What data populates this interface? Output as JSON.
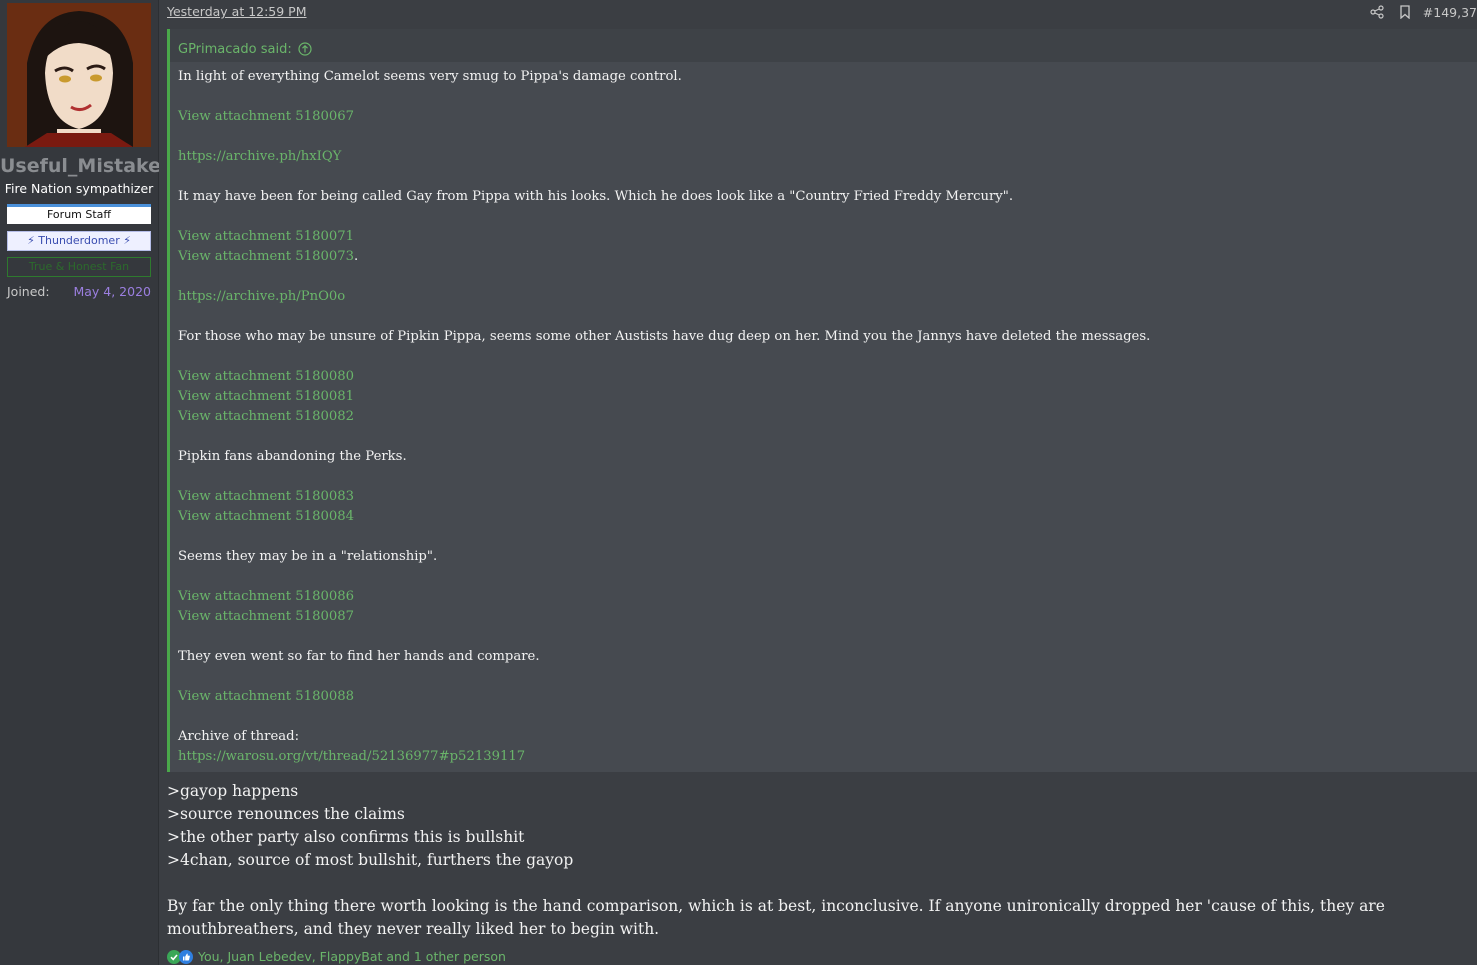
{
  "user": {
    "name": "Useful_Mistake",
    "title": "Fire Nation sympathizer",
    "banners": [
      "Forum Staff",
      "⚡ Thunderdomer ⚡",
      "True & Honest Fan"
    ],
    "joined_label": "Joined:",
    "joined_value": "May 4, 2020"
  },
  "post": {
    "date": "Yesterday at 12:59 PM",
    "number": "#149,37",
    "icons": [
      "share-icon",
      "bookmark-icon"
    ]
  },
  "quote": {
    "author": "GPrimacado said:",
    "lines": [
      {
        "text": "In light of everything Camelot seems very smug to Pippa's damage control.",
        "link": false
      },
      {
        "text": "",
        "link": false
      },
      {
        "text": "View attachment 5180067",
        "link": true
      },
      {
        "text": "",
        "link": false
      },
      {
        "text": "https://archive.ph/hxIQY",
        "link": true
      },
      {
        "text": "",
        "link": false
      },
      {
        "text": "It may have been for being called Gay from Pippa with his looks. Which he does look like a \"Country Fried Freddy Mercury\".",
        "link": false
      },
      {
        "text": "",
        "link": false
      },
      {
        "text": "View attachment 5180071",
        "link": true
      },
      {
        "text": "View attachment 5180073",
        "link": true,
        "suffix": "."
      },
      {
        "text": "",
        "link": false
      },
      {
        "text": "https://archive.ph/PnO0o",
        "link": true
      },
      {
        "text": "",
        "link": false
      },
      {
        "text": "For those who may be unsure of Pipkin Pippa, seems some other Austists have dug deep on her. Mind you the Jannys have deleted the messages.",
        "link": false
      },
      {
        "text": "",
        "link": false
      },
      {
        "text": "View attachment 5180080",
        "link": true
      },
      {
        "text": "View attachment 5180081",
        "link": true
      },
      {
        "text": "View attachment 5180082",
        "link": true
      },
      {
        "text": "",
        "link": false
      },
      {
        "text": "Pipkin fans abandoning the Perks.",
        "link": false
      },
      {
        "text": "",
        "link": false
      },
      {
        "text": "View attachment 5180083",
        "link": true
      },
      {
        "text": "View attachment 5180084",
        "link": true
      },
      {
        "text": "",
        "link": false
      },
      {
        "text": "Seems they may be in a \"relationship\".",
        "link": false
      },
      {
        "text": "",
        "link": false
      },
      {
        "text": "View attachment 5180086",
        "link": true
      },
      {
        "text": "View attachment 5180087",
        "link": true
      },
      {
        "text": "",
        "link": false
      },
      {
        "text": "They even went so far to find her hands and compare.",
        "link": false
      },
      {
        "text": "",
        "link": false
      },
      {
        "text": "View attachment 5180088",
        "link": true
      },
      {
        "text": "",
        "link": false
      },
      {
        "text": "Archive of thread:",
        "link": false
      },
      {
        "text": "https://warosu.org/vt/thread/52136977#p52139117",
        "link": true
      }
    ]
  },
  "reply": {
    "greentext": [
      ">gayop happens",
      ">source renounces the claims",
      ">the other party also confirms this is bullshit",
      ">4chan, source of most bullshit, furthers the gayop"
    ],
    "paragraph": "By far the only thing there worth looking is the hand comparison, which is at best, inconclusive. If anyone unironically dropped her 'cause of this, they are mouthbreathers, and they never really liked her to begin with."
  },
  "reactions": {
    "text": "You, Juan Lebedev, FlappyBat and 1 other person",
    "icons": [
      "check-icon",
      "thumbs-up-icon"
    ],
    "colors": {
      "check": "#3aa757",
      "like": "#2f7fe0"
    }
  },
  "colors": {
    "accent": "#4aa84a",
    "link": "#6ab56a",
    "joined": "#9b7fe0"
  }
}
